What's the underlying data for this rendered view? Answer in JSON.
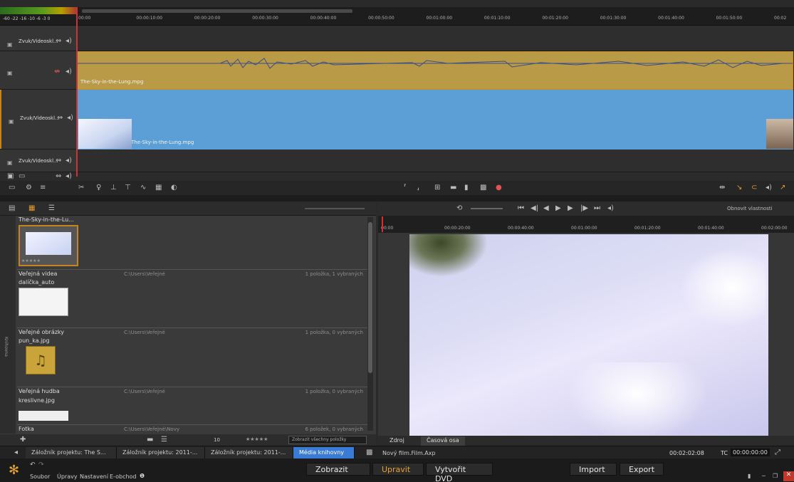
{
  "timeline": {
    "meter_scale": "-60  -22 -16  -10  -6  -3  0",
    "ticks": [
      "00:00",
      "00:00:10:00",
      "00:00:20:00",
      "00:00:30:00",
      "00:00:40:00",
      "00:00:50:00",
      "00:01:00:00",
      "00:01:10:00",
      "00:01:20:00",
      "00:01:30:00",
      "00:01:40:00",
      "00:01:50:00",
      "00:02"
    ],
    "tracks": [
      {
        "name": "Zvuk/Videoskl..."
      },
      {
        "name": ""
      },
      {
        "name": "Zvuk/Videoskl..."
      },
      {
        "name": "Zvuk/Videoskl..."
      }
    ],
    "audio_clip_label": "The-Sky-in-the-Lung.mpg",
    "video_clip_label": "The-Sky-in-the-Lung.mpg"
  },
  "library": {
    "sections": [
      {
        "title": "Veřejná videa",
        "path": "C:\\Users\\Veřejné",
        "count": "1 položka, 1 vybraných"
      },
      {
        "title": "Veřejné obrázky",
        "path": "C:\\Users\\Veřejné",
        "count": "1 položka, 0 vybraných"
      },
      {
        "title": "Veřejná hudba",
        "path": "C:\\Users\\Veřejné",
        "count": "1 položka, 0 vybraných"
      },
      {
        "title": "Fotka",
        "path": "C:\\Users\\Veřejné\\Novy",
        "count": "6 položek, 0 vybraných"
      }
    ],
    "items": [
      {
        "label": "The-Sky-in-the-Lu..."
      },
      {
        "label": "dalíčka_auto"
      },
      {
        "label": "pun_ka.jpg"
      },
      {
        "label": "kreslivne.jpg"
      }
    ],
    "side_label": "Knihovna",
    "bottom_count": "10",
    "bottom_stars": "★★★★★",
    "filter_text": "Zobrazit všechny položky",
    "stars": "★★★★★"
  },
  "preview": {
    "header_right": "Obnovit vlastnosti",
    "ticks": [
      "00:00",
      "00:00:20:00",
      "00:00:40:00",
      "00:01:00:00",
      "00:01:20:00",
      "00:01:40:00",
      "00:02:00:00"
    ],
    "tabs": [
      "Zdroj",
      "Časová osa"
    ],
    "tc_total": "00:02:02:08",
    "tc_label": "TC",
    "tc_current": "00:00:00:00",
    "file_label": "Nový film.Film.Axp"
  },
  "project_tabs": [
    "Záložník projektu: The S...",
    "Záložník projektu: 2011-...",
    "Záložník projektu: 2011-...",
    "Média knihovny"
  ],
  "menu": {
    "items": [
      "Soubor",
      "Úpravy",
      "Nastavení",
      "E-obchod"
    ],
    "buttons": [
      "Zobrazit",
      "Upravit",
      "Vytvořit DVD",
      "Import",
      "Export"
    ]
  },
  "colors": {
    "accent": "#c8841a",
    "audio": "#b89a47",
    "video": "#5b9fd6"
  }
}
